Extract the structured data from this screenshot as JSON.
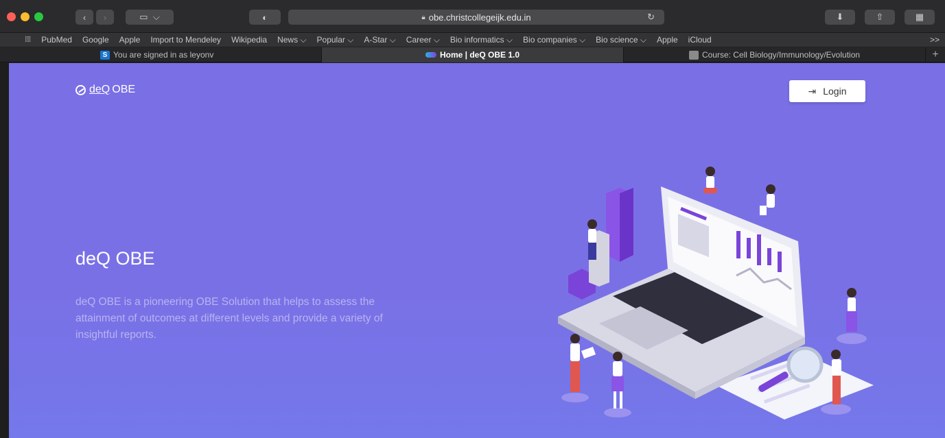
{
  "browser": {
    "url": "obe.christcollegeijk.edu.in",
    "bookmarks": [
      "PubMed",
      "Google",
      "Apple",
      "Import to Mendeley",
      "Wikipedia",
      "News ⌵",
      "Popular ⌵",
      "A-Star ⌵",
      "Career ⌵",
      "Bio informatics ⌵",
      "Bio companies ⌵",
      "Bio science ⌵",
      "Apple",
      "iCloud"
    ],
    "more": ">>",
    "tabs": [
      {
        "title": "You are signed in as leyonv",
        "favicon": "S"
      },
      {
        "title": "Home | deQ OBE 1.0"
      },
      {
        "title": "Course: Cell Biology/Immunology/Evolution"
      }
    ],
    "new_tab": "+"
  },
  "page": {
    "logo_prefix": "deQ",
    "logo_suffix": "OBE",
    "login_label": "Login",
    "title": "deQ OBE",
    "description": "deQ OBE is a pioneering OBE Solution that helps to assess the attainment of outcomes at different levels and provide a variety of insightful reports."
  },
  "colors": {
    "background": "#7a70e6",
    "accent": "#7a44d8",
    "chrome": "#2b2b2d"
  }
}
